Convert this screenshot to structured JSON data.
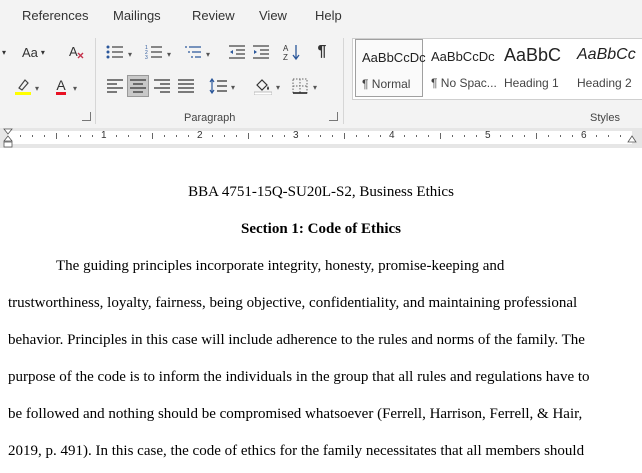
{
  "tabs": [
    "References",
    "Mailings",
    "Review",
    "View",
    "Help"
  ],
  "font_group": {
    "font_size_label": "Aa",
    "highlight_color": "#ffff00",
    "font_color": "#e81123",
    "font_color_glyph": "A",
    "icons": [
      "change-case-icon",
      "clear-formatting-icon",
      "highlight-icon",
      "font-color-icon"
    ]
  },
  "paragraph_group": {
    "label": "Paragraph",
    "icons": [
      "bullets-icon",
      "numbering-icon",
      "multilevel-list-icon",
      "decrease-indent-icon",
      "increase-indent-icon",
      "sort-icon",
      "show-formatting-marks-icon",
      "align-left-icon",
      "align-center-icon",
      "align-right-icon",
      "justify-icon",
      "line-spacing-icon",
      "shading-icon",
      "borders-icon"
    ],
    "show_marks_glyph": "¶"
  },
  "styles_group": {
    "label": "Styles",
    "items": [
      {
        "sample": "AaBbCcDc",
        "name": "¶ Normal"
      },
      {
        "sample": "AaBbCcDc",
        "name": "¶ No Spac..."
      },
      {
        "sample": "AaBbC",
        "name": "Heading 1"
      },
      {
        "sample": "AaBbCc",
        "name": "Heading 2"
      }
    ]
  },
  "ruler": {
    "numbers": [
      "1",
      "2",
      "3",
      "4",
      "5",
      "6"
    ]
  },
  "document": {
    "title": "BBA 4751-15Q-SU20L-S2, Business Ethics",
    "section_heading": "Section 1: Code of Ethics",
    "lines": [
      "The guiding principles incorporate integrity, honesty, promise-keeping and",
      "trustworthiness, loyalty, fairness, being objective, confidentiality, and maintaining professional",
      "behavior. Principles in this case will include adherence to the rules and norms of the family. The",
      "purpose of the code is to inform the individuals in the group that all rules and regulations have to",
      "be followed and nothing should be compromised whatsoever (Ferrell, Harrison, Ferrell, & Hair,",
      "2019, p. 491). In this case, the code of ethics for the family necessitates that all members should"
    ]
  }
}
